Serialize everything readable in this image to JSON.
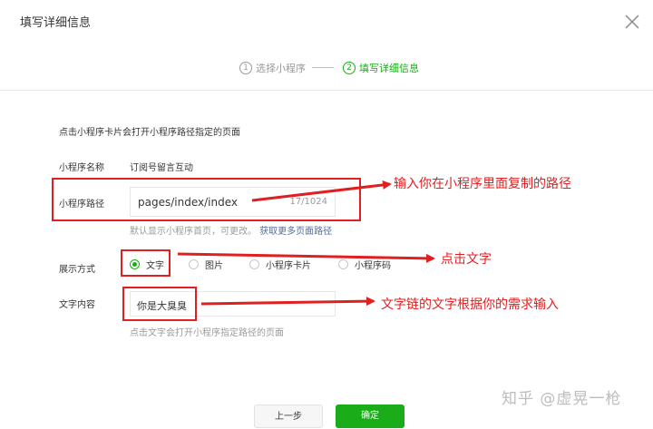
{
  "dialog": {
    "title": "填写详细信息",
    "close_icon": "close-icon"
  },
  "steps": [
    {
      "num": "1",
      "label": "选择小程序",
      "active": false
    },
    {
      "num": "2",
      "label": "填写详细信息",
      "active": true
    }
  ],
  "form": {
    "description": "点击小程序卡片会打开小程序路径指定的页面",
    "mini_program_name_label": "小程序名称",
    "mini_program_name_value": "订阅号留言互动",
    "path_label": "小程序路径",
    "path_value": "pages/index/index",
    "path_counter": "17/1024",
    "path_hint": "默认显示小程序首页，可更改。",
    "path_hint_link": "获取更多页面路径",
    "display_label": "展示方式",
    "display_options": [
      {
        "label": "文字",
        "checked": true
      },
      {
        "label": "图片",
        "checked": false
      },
      {
        "label": "小程序卡片",
        "checked": false
      },
      {
        "label": "小程序码",
        "checked": false
      }
    ],
    "text_content_label": "文字内容",
    "text_content_value": "你是大臭臭",
    "text_content_hint": "点击文字会打开小程序指定路径的页面"
  },
  "annotations": {
    "path": "输入你在小程序里面复制的路径",
    "display": "点击文字",
    "text": "文字链的文字根据你的需求输入"
  },
  "buttons": {
    "prev": "上一步",
    "ok": "确定"
  },
  "watermark": "知乎 @虚晃一枪",
  "colors": {
    "accent": "#1aad19",
    "annotation_red": "#e02020",
    "link": "#576b95"
  }
}
